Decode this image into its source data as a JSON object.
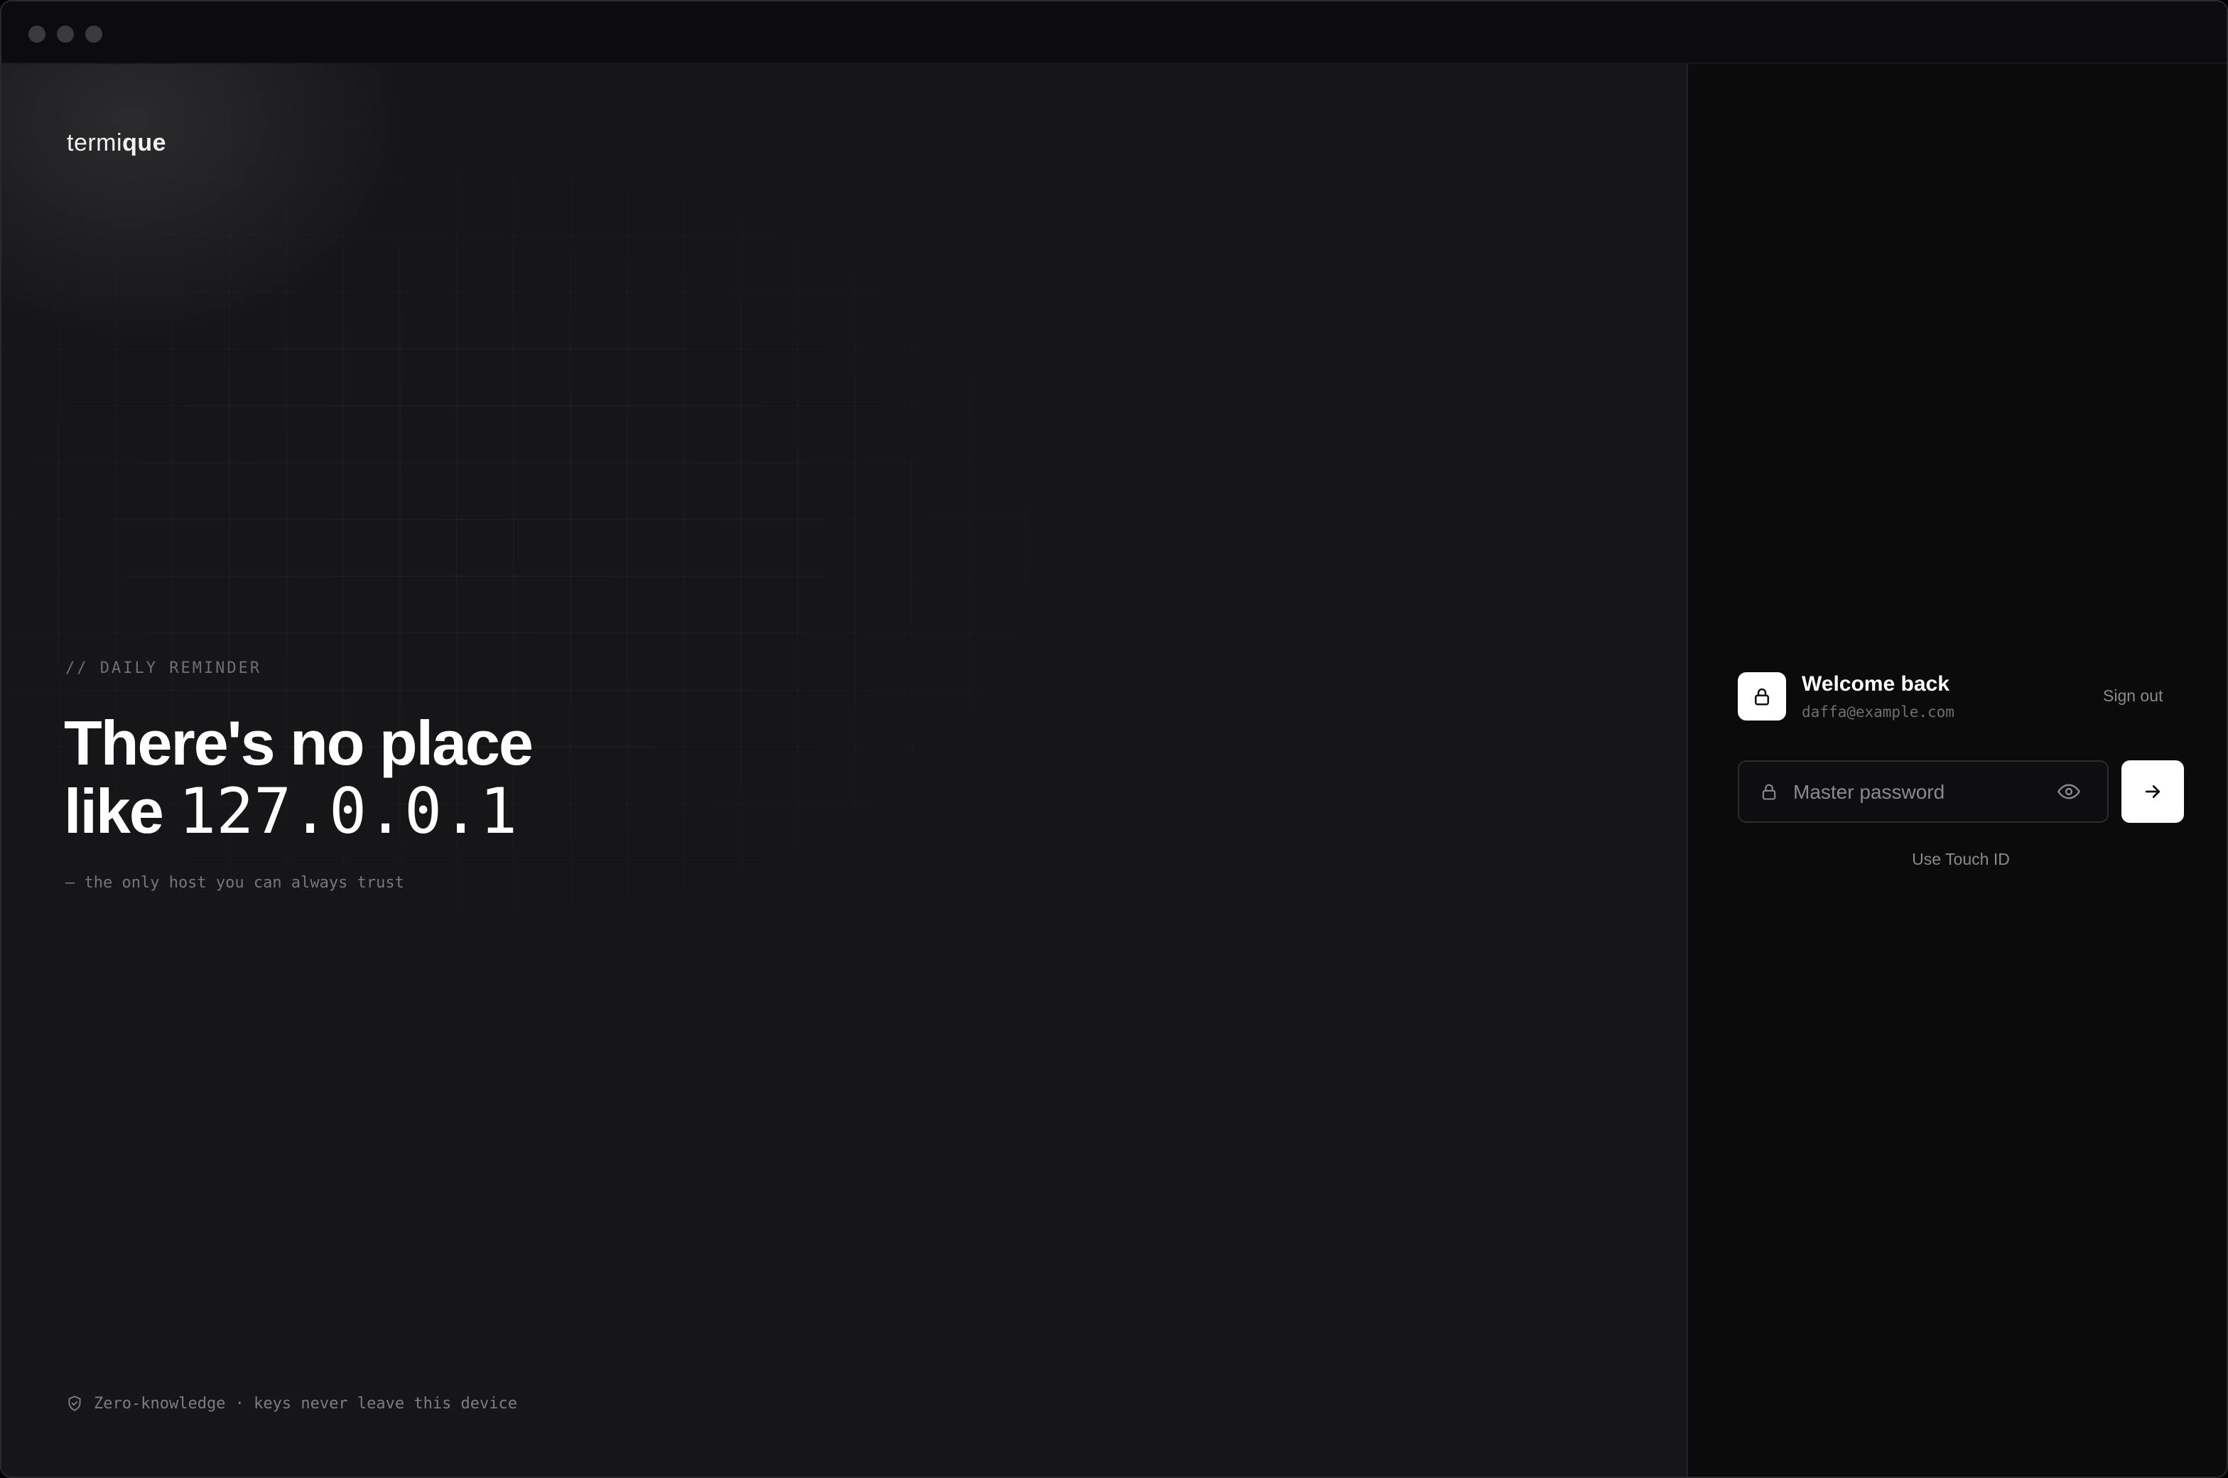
{
  "brand": {
    "light": "termi",
    "bold": "que"
  },
  "hero": {
    "eyebrow": "// DAILY REMINDER",
    "line1": "There's no place",
    "line2_prefix": "like ",
    "line2_mono": "127.0.0.1",
    "subline": "— the only host you can always trust"
  },
  "footer": {
    "text": "Zero-knowledge · keys never leave this device",
    "icon": "shield-icon"
  },
  "login": {
    "title": "Welcome back",
    "email": "daffa@example.com",
    "sign_out": "Sign out",
    "password_placeholder": "Master password",
    "password_value": "",
    "touch_id": "Use Touch ID",
    "icons": [
      "lock-icon",
      "eye-icon",
      "arrow-right-icon"
    ]
  },
  "colors": {
    "left_bg": "#161618",
    "right_bg": "#0b0b0c",
    "accent": "#ffffff",
    "muted": "#8a8a8f"
  }
}
